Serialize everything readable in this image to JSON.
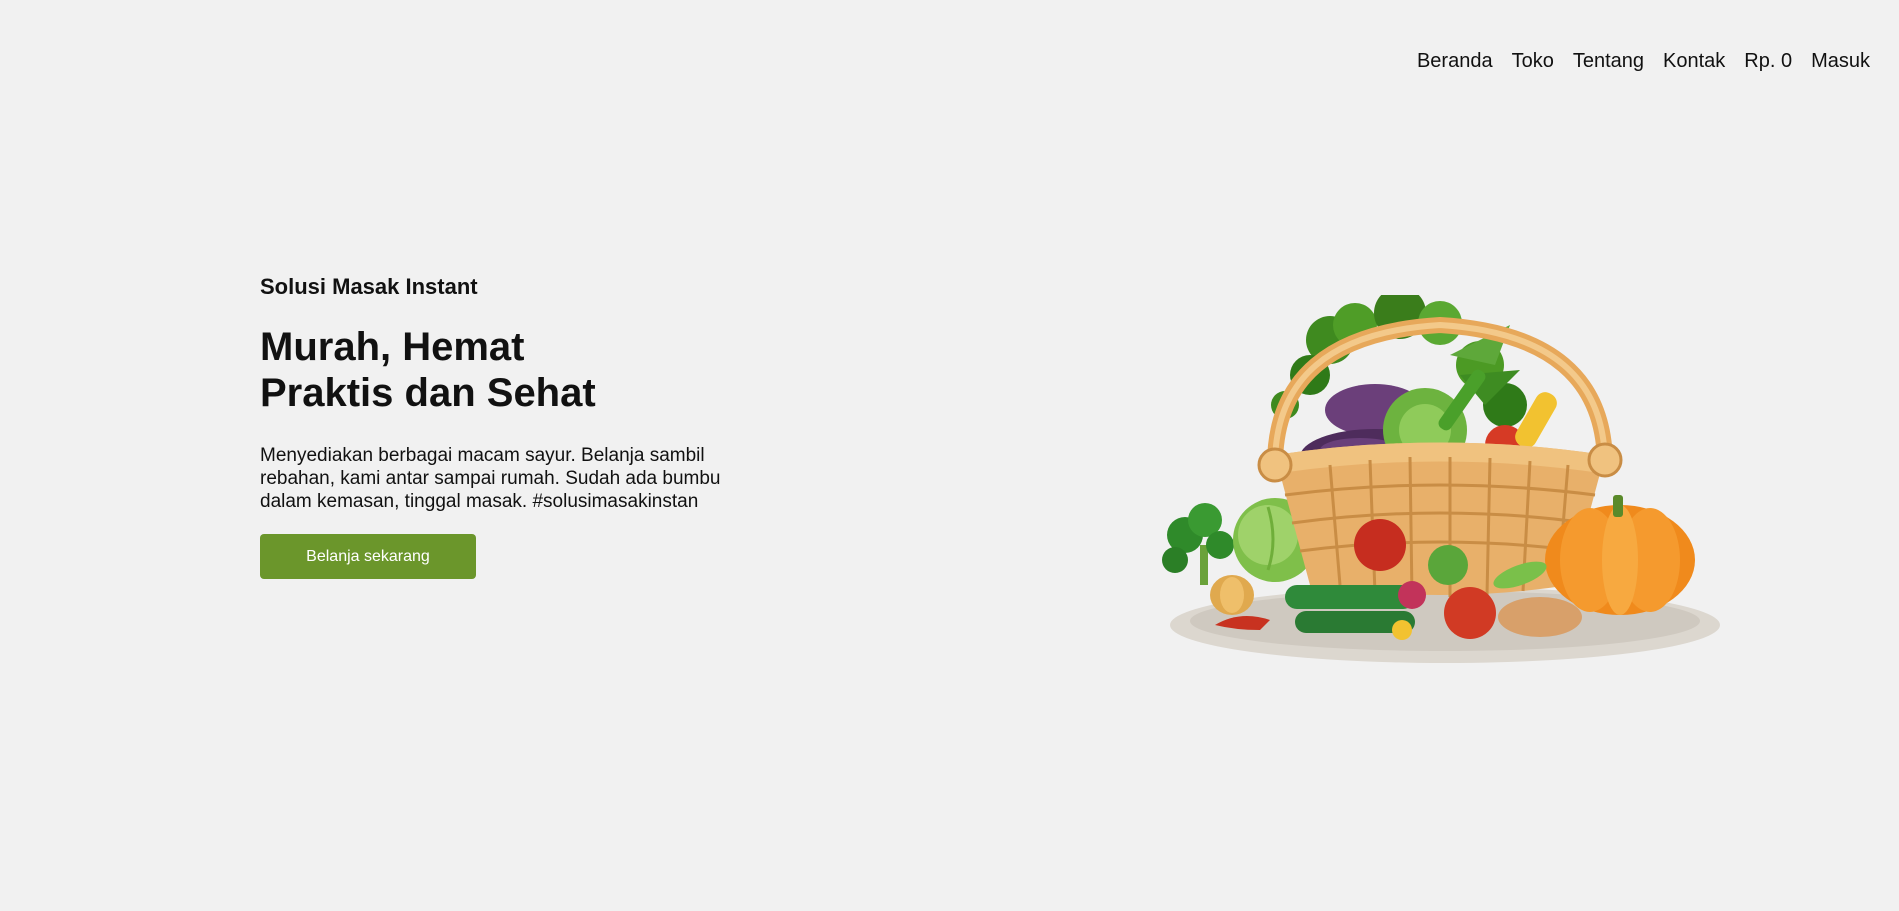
{
  "nav": {
    "items": [
      "Beranda",
      "Toko",
      "Tentang",
      "Kontak"
    ],
    "cart_total": "Rp. 0",
    "login": "Masuk"
  },
  "hero": {
    "tagline": "Solusi Masak Instant",
    "headline_line1": "Murah, Hemat",
    "headline_line2": "Praktis dan Sehat",
    "description": "Menyediakan berbagai macam sayur. Belanja sambil rebahan, kami antar sampai rumah. Sudah ada bumbu dalam kemasan, tinggal masak. #solusimasakinstan",
    "cta_label": "Belanja sekarang"
  },
  "colors": {
    "background": "#f1f1f1",
    "accent": "#6b962b"
  },
  "illustration": "vegetable-basket-illustration"
}
